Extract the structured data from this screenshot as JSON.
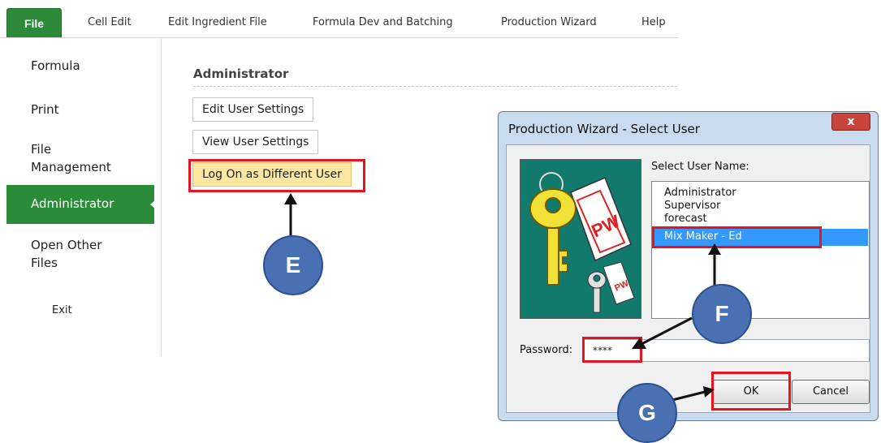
{
  "ribbon": {
    "file_tab": "File",
    "tabs": [
      "Cell Edit",
      "Edit Ingredient File",
      "Formula Dev and Batching",
      "Production Wizard",
      "Help"
    ]
  },
  "sidebar": {
    "items": [
      "Formula",
      "Print",
      "File\nManagement",
      "Administrator",
      "Open Other\nFiles",
      "Exit"
    ],
    "active": "Administrator"
  },
  "admin": {
    "title": "Administrator",
    "buttons": [
      "Edit User Settings",
      "View User Settings",
      "Log On as Different User"
    ]
  },
  "callouts": {
    "e": "E",
    "f": "F",
    "g": "G"
  },
  "dialog": {
    "title": "Production Wizard - Select User",
    "close": "x",
    "select_label": "Select User Name:",
    "users": [
      "Administrator",
      "Supervisor",
      "forecast",
      "Mix Maker - Ed"
    ],
    "selected_user": "Mix Maker - Ed",
    "password_label": "Password:",
    "password_value": "****",
    "ok": "OK",
    "cancel": "Cancel"
  },
  "colors": {
    "green": "#2a8c39",
    "highlight": "#fbe6a2",
    "annotation_red": "#e8131c",
    "callout_blue": "#4a70b4",
    "selection_blue": "#3399ff"
  },
  "icons": [
    "key-icon",
    "small-key-icon",
    "pw-tag-icon",
    "arrow-up-icon",
    "arrow-icon"
  ]
}
